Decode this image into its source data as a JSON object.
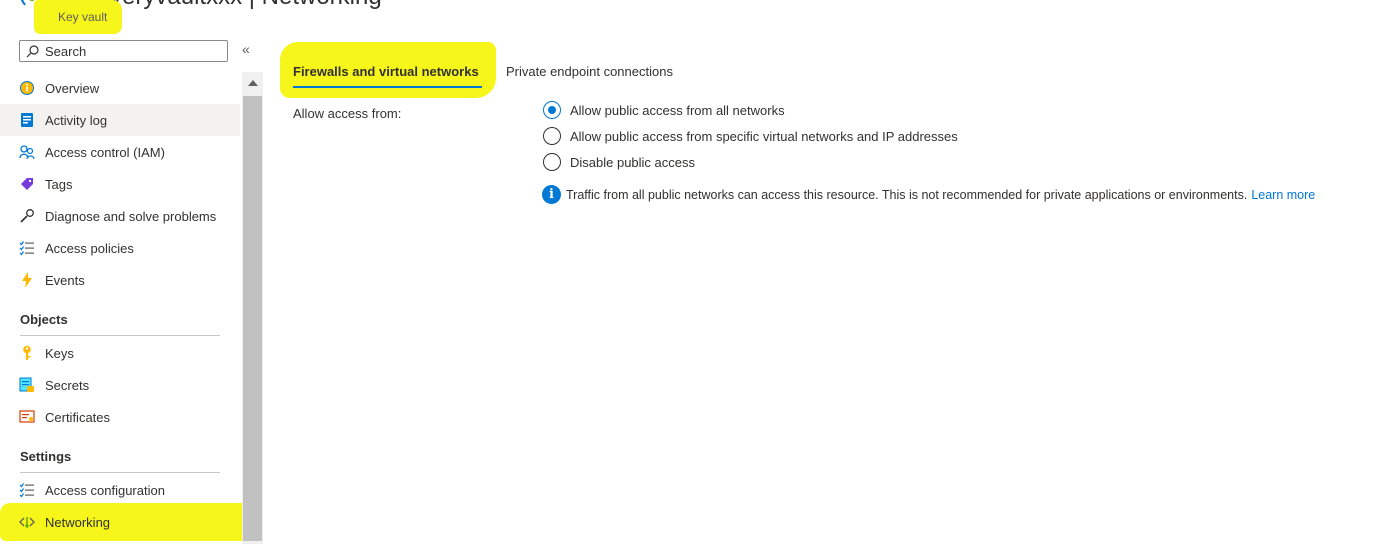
{
  "header": {
    "title": "Recoveryvaultxxx | Networking",
    "subtitle": "Key vault"
  },
  "sidebar": {
    "search_placeholder": "Search",
    "collapse_glyph": "«",
    "items": [
      {
        "label": "Overview",
        "icon": "overview-icon"
      },
      {
        "label": "Activity log",
        "icon": "activity-log-icon"
      },
      {
        "label": "Access control (IAM)",
        "icon": "people-icon"
      },
      {
        "label": "Tags",
        "icon": "tag-icon"
      },
      {
        "label": "Diagnose and solve problems",
        "icon": "wrench-icon"
      },
      {
        "label": "Access policies",
        "icon": "list-icon"
      },
      {
        "label": "Events",
        "icon": "lightning-icon"
      }
    ],
    "sections": [
      {
        "heading": "Objects",
        "items": [
          {
            "label": "Keys",
            "icon": "key-icon"
          },
          {
            "label": "Secrets",
            "icon": "secret-icon"
          },
          {
            "label": "Certificates",
            "icon": "certificate-icon"
          }
        ]
      },
      {
        "heading": "Settings",
        "items": [
          {
            "label": "Access configuration",
            "icon": "list-icon"
          },
          {
            "label": "Networking",
            "icon": "networking-icon"
          }
        ]
      }
    ]
  },
  "tabs": [
    {
      "label": "Firewalls and virtual networks",
      "active": true
    },
    {
      "label": "Private endpoint connections",
      "active": false
    }
  ],
  "content": {
    "field_label": "Allow access from:",
    "options": [
      {
        "label": "Allow public access from all networks",
        "checked": true
      },
      {
        "label": "Allow public access from specific virtual networks and IP addresses",
        "checked": false
      },
      {
        "label": "Disable public access",
        "checked": false
      }
    ],
    "info_text": "Traffic from all public networks can access this resource. This is not recommended for private applications or environments.",
    "learn_more": "Learn more"
  },
  "colors": {
    "accent": "#0078d4",
    "highlight": "#f6f61a"
  }
}
